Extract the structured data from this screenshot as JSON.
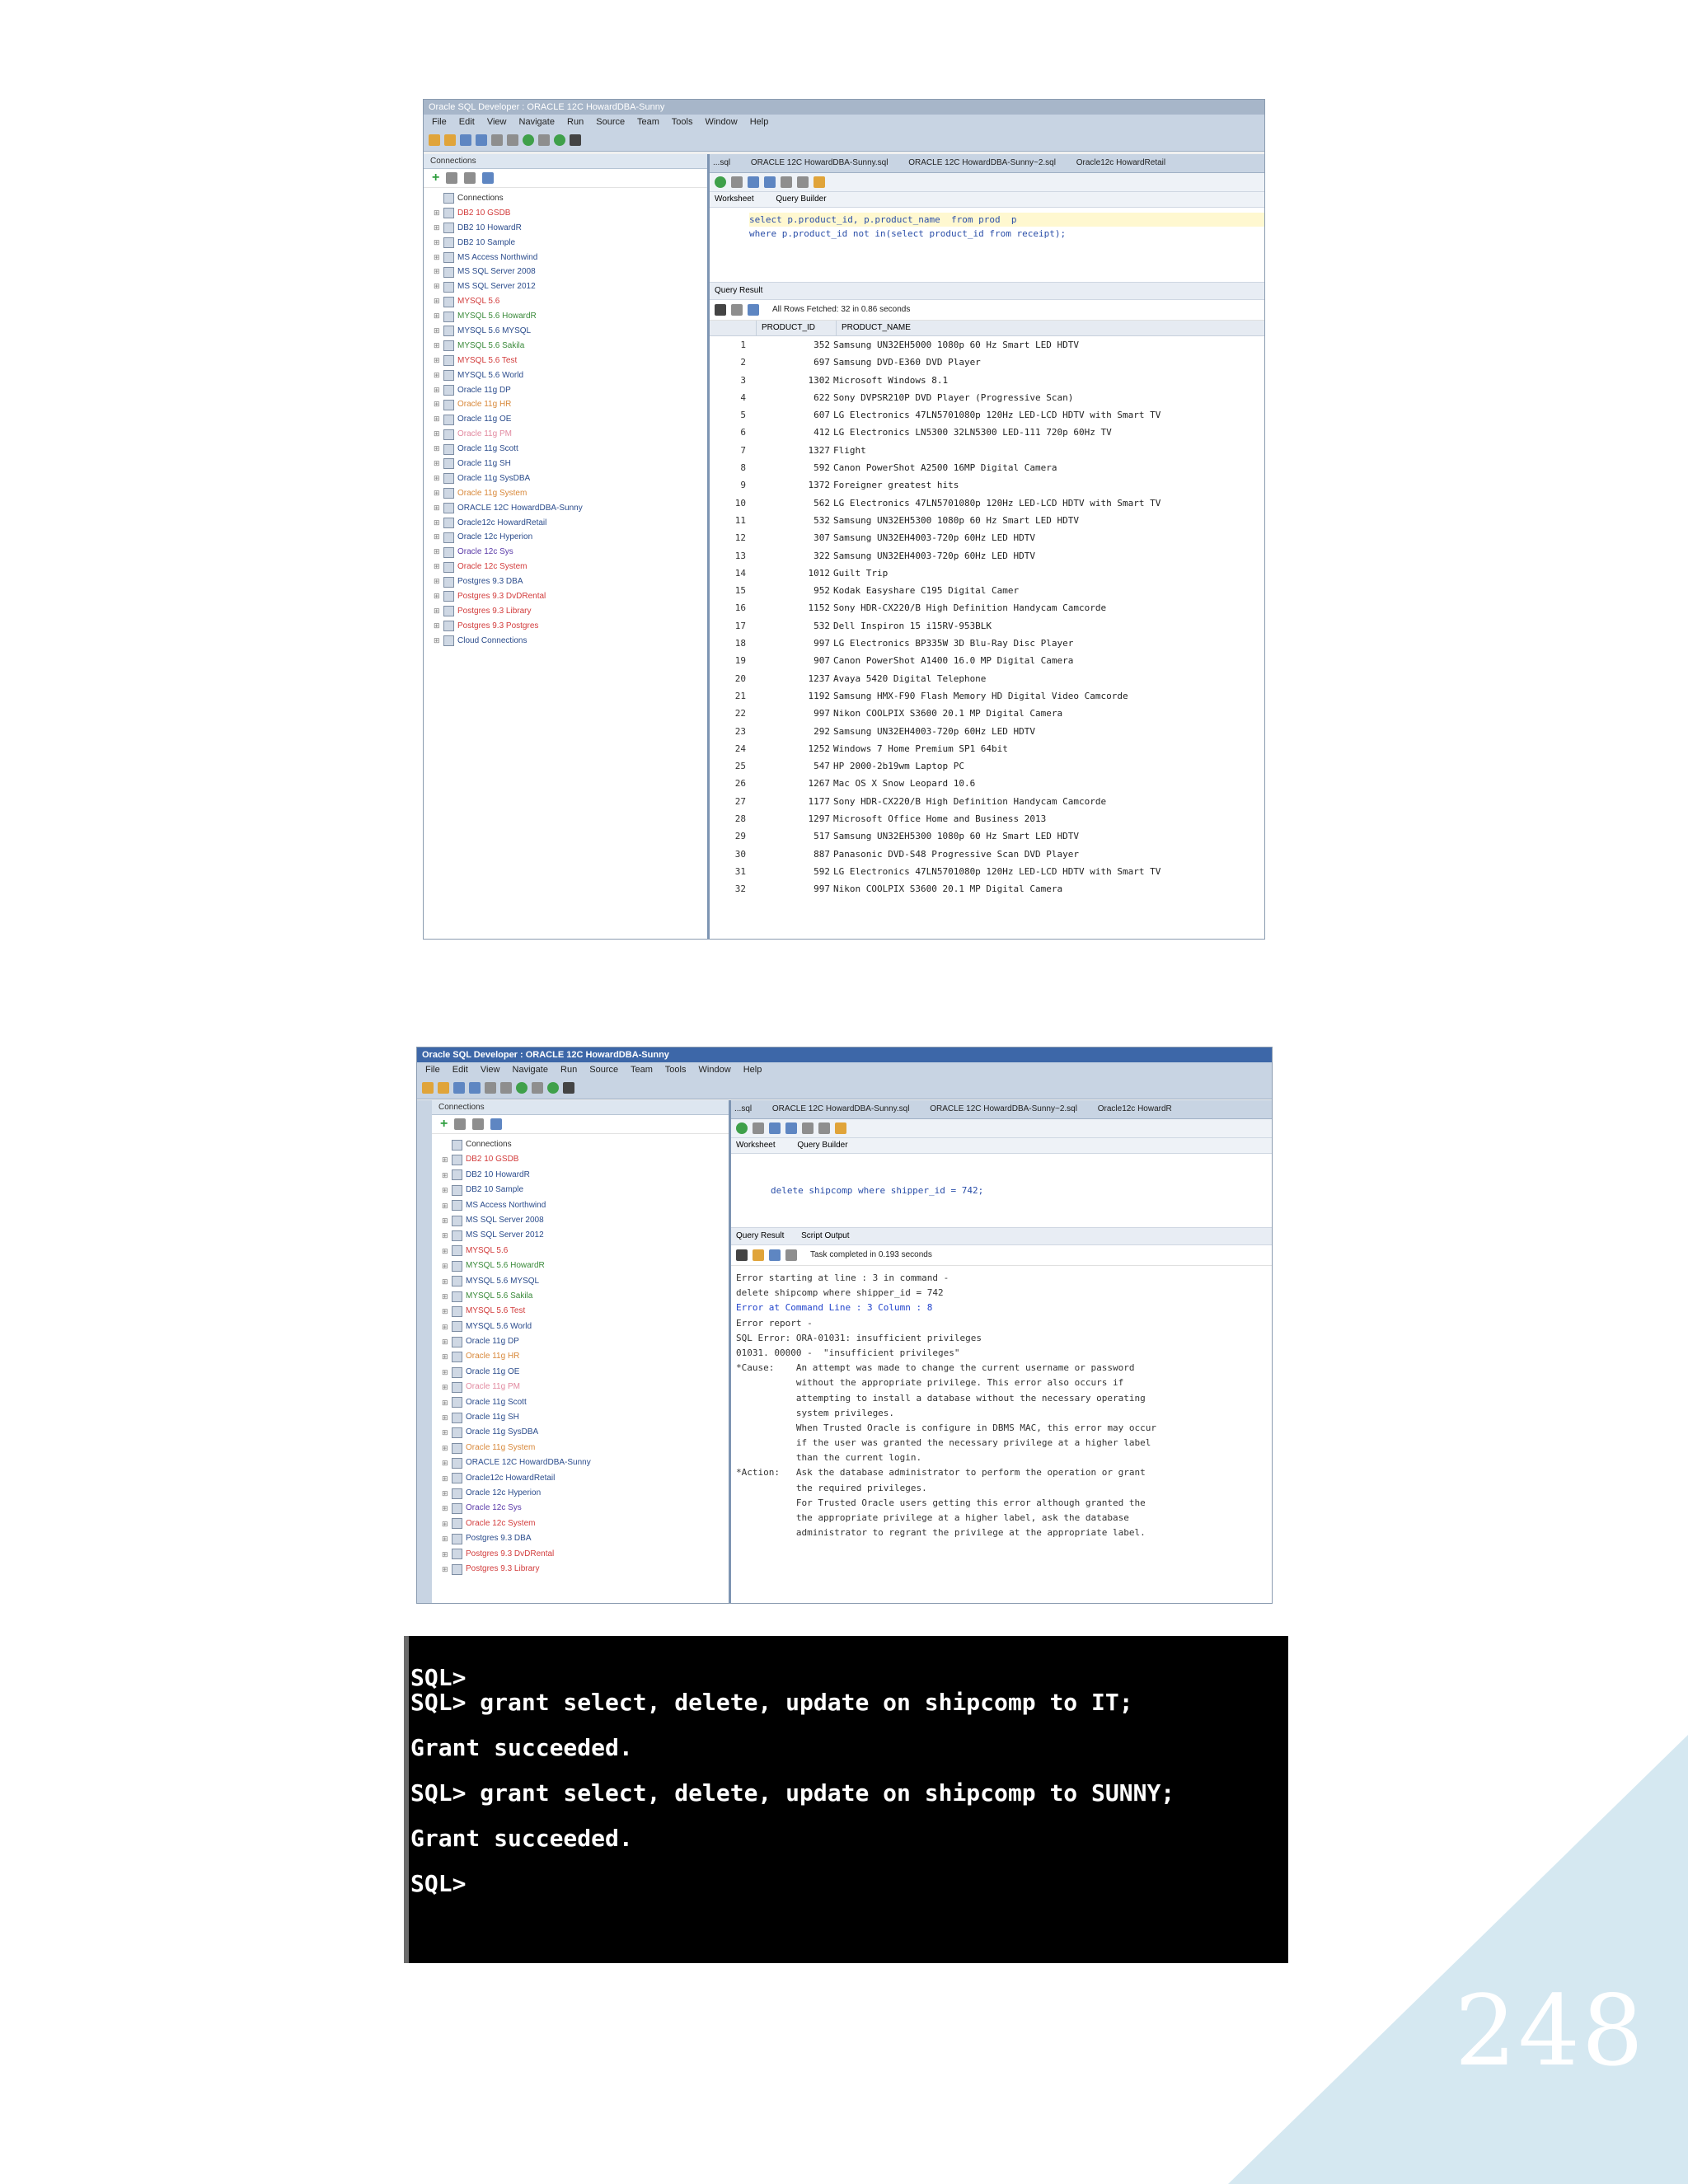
{
  "page_number": "248",
  "window1": {
    "title": "Oracle SQL Developer : ORACLE 12C HowardDBA-Sunny",
    "menu": [
      "File",
      "Edit",
      "View",
      "Navigate",
      "Run",
      "Source",
      "Team",
      "Tools",
      "Window",
      "Help"
    ],
    "connections_label": "Connections",
    "doc_tabs": [
      "...sql",
      "ORACLE 12C HowardDBA-Sunny.sql",
      "ORACLE 12C HowardDBA-Sunny~2.sql",
      "Oracle12c HowardRetail"
    ],
    "sub_tabs": [
      "Worksheet",
      "Query Builder"
    ],
    "sql_lines": [
      "select p.product_id, p.product_name  from prod  p",
      "where p.product_id not in(select product_id from receipt);"
    ],
    "result_tab": "Query Result",
    "result_message": "All Rows Fetched: 32 in 0.86 seconds",
    "columns": [
      "PRODUCT_ID",
      "PRODUCT_NAME"
    ],
    "tree": [
      {
        "label": "Connections",
        "type": "root"
      },
      {
        "label": "DB2 10 GSDB",
        "type": "red"
      },
      {
        "label": "DB2 10 HowardR",
        "type": "blue"
      },
      {
        "label": "DB2 10 Sample",
        "type": "blue"
      },
      {
        "label": "MS Access Northwind",
        "type": "blue"
      },
      {
        "label": "MS SQL Server 2008",
        "type": "blue"
      },
      {
        "label": "MS SQL Server 2012",
        "type": "blue"
      },
      {
        "label": "MYSQL 5.6",
        "type": "red"
      },
      {
        "label": "MYSQL 5.6 HowardR",
        "type": "grn"
      },
      {
        "label": "MYSQL 5.6 MYSQL",
        "type": "blue"
      },
      {
        "label": "MYSQL 5.6 Sakila",
        "type": "grn"
      },
      {
        "label": "MYSQL 5.6 Test",
        "type": "red"
      },
      {
        "label": "MYSQL 5.6 World",
        "type": "blue"
      },
      {
        "label": "Oracle 11g DP",
        "type": "blue"
      },
      {
        "label": "Oracle 11g HR",
        "type": "org"
      },
      {
        "label": "Oracle 11g OE",
        "type": "blue"
      },
      {
        "label": "Oracle 11g PM",
        "type": "pink"
      },
      {
        "label": "Oracle 11g Scott",
        "type": "blue"
      },
      {
        "label": "Oracle 11g SH",
        "type": "blue"
      },
      {
        "label": "Oracle 11g SysDBA",
        "type": "blue"
      },
      {
        "label": "Oracle 11g System",
        "type": "org"
      },
      {
        "label": "ORACLE 12C HowardDBA-Sunny",
        "type": "blue"
      },
      {
        "label": "Oracle12c HowardRetail",
        "type": "blue"
      },
      {
        "label": "Oracle 12c Hyperion",
        "type": "blue"
      },
      {
        "label": "Oracle 12c Sys",
        "type": "vio"
      },
      {
        "label": "Oracle 12c System",
        "type": "red"
      },
      {
        "label": "Postgres 9.3 DBA",
        "type": "blue"
      },
      {
        "label": "Postgres 9.3 DvDRental",
        "type": "red"
      },
      {
        "label": "Postgres 9.3 Library",
        "type": "red"
      },
      {
        "label": "Postgres 9.3 Postgres",
        "type": "red"
      },
      {
        "label": "Cloud Connections",
        "type": "blue"
      }
    ],
    "rows": [
      [
        "1",
        "352",
        "Samsung UN32EH5000  1080p 60 Hz Smart LED HDTV"
      ],
      [
        "2",
        "697",
        "Samsung DVD-E360 DVD Player"
      ],
      [
        "3",
        "1302",
        "Microsoft Windows 8.1"
      ],
      [
        "4",
        "622",
        "Sony DVPSR210P DVD Player (Progressive Scan)"
      ],
      [
        "5",
        "607",
        "LG Electronics 47LN5701080p 120Hz LED-LCD HDTV with Smart TV"
      ],
      [
        "6",
        "412",
        "LG Electronics LN5300 32LN5300 LED-111 720p 60Hz TV"
      ],
      [
        "7",
        "1327",
        "Flight"
      ],
      [
        "8",
        "592",
        "Canon PowerShot A2500 16MP Digital Camera"
      ],
      [
        "9",
        "1372",
        "Foreigner greatest hits"
      ],
      [
        "10",
        "562",
        "LG Electronics 47LN5701080p 120Hz LED-LCD HDTV with Smart TV"
      ],
      [
        "11",
        "532",
        "Samsung UN32EH5300  1080p 60 Hz Smart LED HDTV"
      ],
      [
        "12",
        "307",
        "Samsung UN32EH4003-720p 60Hz LED HDTV"
      ],
      [
        "13",
        "322",
        "Samsung UN32EH4003-720p 60Hz LED HDTV"
      ],
      [
        "14",
        "1012",
        "Guilt Trip"
      ],
      [
        "15",
        "952",
        "Kodak Easyshare C195 Digital Camer"
      ],
      [
        "16",
        "1152",
        "Sony HDR-CX220/B High Definition Handycam Camcorde"
      ],
      [
        "17",
        "532",
        "Dell Inspiron 15 i15RV-953BLK"
      ],
      [
        "18",
        "997",
        "LG Electronics BP335W 3D Blu-Ray Disc Player"
      ],
      [
        "19",
        "907",
        "Canon PowerShot A1400 16.0 MP Digital Camera"
      ],
      [
        "20",
        "1237",
        "Avaya 5420 Digital Telephone"
      ],
      [
        "21",
        "1192",
        "Samsung HMX-F90 Flash Memory HD Digital Video Camcorde"
      ],
      [
        "22",
        "997",
        "Nikon COOLPIX S3600 20.1 MP Digital Camera"
      ],
      [
        "23",
        "292",
        "Samsung UN32EH4003-720p 60Hz LED HDTV"
      ],
      [
        "24",
        "1252",
        "Windows 7 Home Premium SP1 64bit"
      ],
      [
        "25",
        "547",
        "HP 2000-2b19wm  Laptop PC"
      ],
      [
        "26",
        "1267",
        "Mac OS X Snow Leopard 10.6"
      ],
      [
        "27",
        "1177",
        "Sony HDR-CX220/B High Definition Handycam Camcorde"
      ],
      [
        "28",
        "1297",
        "Microsoft Office Home and Business 2013"
      ],
      [
        "29",
        "517",
        "Samsung UN32EH5300  1080p 60 Hz Smart LED HDTV"
      ],
      [
        "30",
        "887",
        "Panasonic DVD-S48 Progressive Scan DVD Player"
      ],
      [
        "31",
        "592",
        "LG Electronics 47LN5701080p 120Hz LED-LCD HDTV with Smart TV"
      ],
      [
        "32",
        "997",
        "Nikon COOLPIX S3600 20.1 MP Digital Camera"
      ]
    ]
  },
  "window2": {
    "title": "Oracle SQL Developer : ORACLE 12C HowardDBA-Sunny",
    "menu": [
      "File",
      "Edit",
      "View",
      "Navigate",
      "Run",
      "Source",
      "Team",
      "Tools",
      "Window",
      "Help"
    ],
    "connections_label": "Connections",
    "doc_tabs": [
      "...sql",
      "ORACLE 12C HowardDBA-Sunny.sql",
      "ORACLE 12C HowardDBA-Sunny~2.sql",
      "Oracle12c HowardR"
    ],
    "sub_tabs": [
      "Worksheet",
      "Query Builder"
    ],
    "sql_line": "delete shipcomp where shipper_id = 742;",
    "result_tabs": [
      "Query Result",
      "Script Output"
    ],
    "result_message": "Task completed in 0.193 seconds",
    "tree": [
      {
        "label": "Connections",
        "type": "root"
      },
      {
        "label": "DB2 10 GSDB",
        "type": "red"
      },
      {
        "label": "DB2 10 HowardR",
        "type": "blue"
      },
      {
        "label": "DB2 10 Sample",
        "type": "blue"
      },
      {
        "label": "MS Access Northwind",
        "type": "blue"
      },
      {
        "label": "MS SQL Server 2008",
        "type": "blue"
      },
      {
        "label": "MS SQL Server 2012",
        "type": "blue"
      },
      {
        "label": "MYSQL 5.6",
        "type": "red"
      },
      {
        "label": "MYSQL 5.6 HowardR",
        "type": "grn"
      },
      {
        "label": "MYSQL 5.6 MYSQL",
        "type": "blue"
      },
      {
        "label": "MYSQL 5.6 Sakila",
        "type": "grn"
      },
      {
        "label": "MYSQL 5.6 Test",
        "type": "red"
      },
      {
        "label": "MYSQL 5.6 World",
        "type": "blue"
      },
      {
        "label": "Oracle 11g DP",
        "type": "blue"
      },
      {
        "label": "Oracle 11g HR",
        "type": "org"
      },
      {
        "label": "Oracle 11g OE",
        "type": "blue"
      },
      {
        "label": "Oracle 11g PM",
        "type": "pink"
      },
      {
        "label": "Oracle 11g Scott",
        "type": "blue"
      },
      {
        "label": "Oracle 11g SH",
        "type": "blue"
      },
      {
        "label": "Oracle 11g SysDBA",
        "type": "blue"
      },
      {
        "label": "Oracle 11g System",
        "type": "org"
      },
      {
        "label": "ORACLE 12C HowardDBA-Sunny",
        "type": "blue"
      },
      {
        "label": "Oracle12c HowardRetail",
        "type": "blue"
      },
      {
        "label": "Oracle 12c Hyperion",
        "type": "blue"
      },
      {
        "label": "Oracle 12c Sys",
        "type": "vio"
      },
      {
        "label": "Oracle 12c System",
        "type": "red"
      },
      {
        "label": "Postgres 9.3 DBA",
        "type": "blue"
      },
      {
        "label": "Postgres 9.3 DvDRental",
        "type": "red"
      },
      {
        "label": "Postgres 9.3 Library",
        "type": "red"
      }
    ],
    "output_lines": [
      "Error starting at line : 3 in command -",
      "delete shipcomp where shipper_id = 742",
      "Error at Command Line : 3 Column : 8",
      "Error report -",
      "SQL Error: ORA-01031: insufficient privileges",
      "01031. 00000 -  \"insufficient privileges\"",
      "*Cause:    An attempt was made to change the current username or password",
      "           without the appropriate privilege. This error also occurs if",
      "           attempting to install a database without the necessary operating",
      "           system privileges.",
      "           When Trusted Oracle is configure in DBMS MAC, this error may occur",
      "           if the user was granted the necessary privilege at a higher label",
      "           than the current login.",
      "*Action:   Ask the database administrator to perform the operation or grant",
      "           the required privileges.",
      "           For Trusted Oracle users getting this error although granted the",
      "           the appropriate privilege at a higher label, ask the database",
      "           administrator to regrant the privilege at the appropriate label."
    ]
  },
  "console": {
    "lines": [
      "SQL>",
      "SQL> grant select, delete, update on shipcomp to IT;",
      "Grant succeeded.",
      "SQL> grant select, delete, update on shipcomp to SUNNY;",
      "Grant succeeded.",
      "SQL>"
    ]
  }
}
